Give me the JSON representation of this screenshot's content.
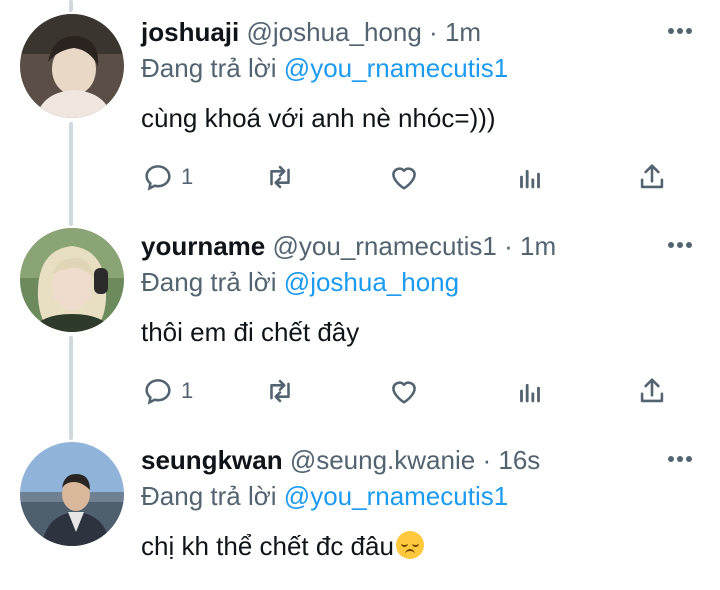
{
  "tweets": [
    {
      "name": "joshuaji",
      "handle": "@joshua_hong",
      "dot": "·",
      "time": "1m",
      "reply_prefix": "Đang trả lời",
      "reply_to": "@you_rnamecutis1",
      "text": "cùng khoá với anh nè nhóc=)))",
      "reply_count": "1",
      "avatar": "person-avatar-light"
    },
    {
      "name": "yourname",
      "handle": "@you_rnamecutis1",
      "dot": "·",
      "time": "1m",
      "reply_prefix": "Đang trả lời",
      "reply_to": "@joshua_hong",
      "text": "thôi em đi chết đây",
      "reply_count": "1",
      "avatar": "person-avatar-headphones"
    },
    {
      "name": "seungkwan",
      "handle": "@seung.kwanie",
      "dot": "·",
      "time": "16s",
      "reply_prefix": "Đang trả lời",
      "reply_to": "@you_rnamecutis1",
      "text": "chị kh thể chết đc đâu",
      "emoji": "disappointed-face",
      "avatar": "person-avatar-outdoor"
    }
  ],
  "colors": {
    "link": "#1d9bf0",
    "muted": "#536471",
    "text": "#0f1419",
    "thread_line": "#cfd9de"
  }
}
